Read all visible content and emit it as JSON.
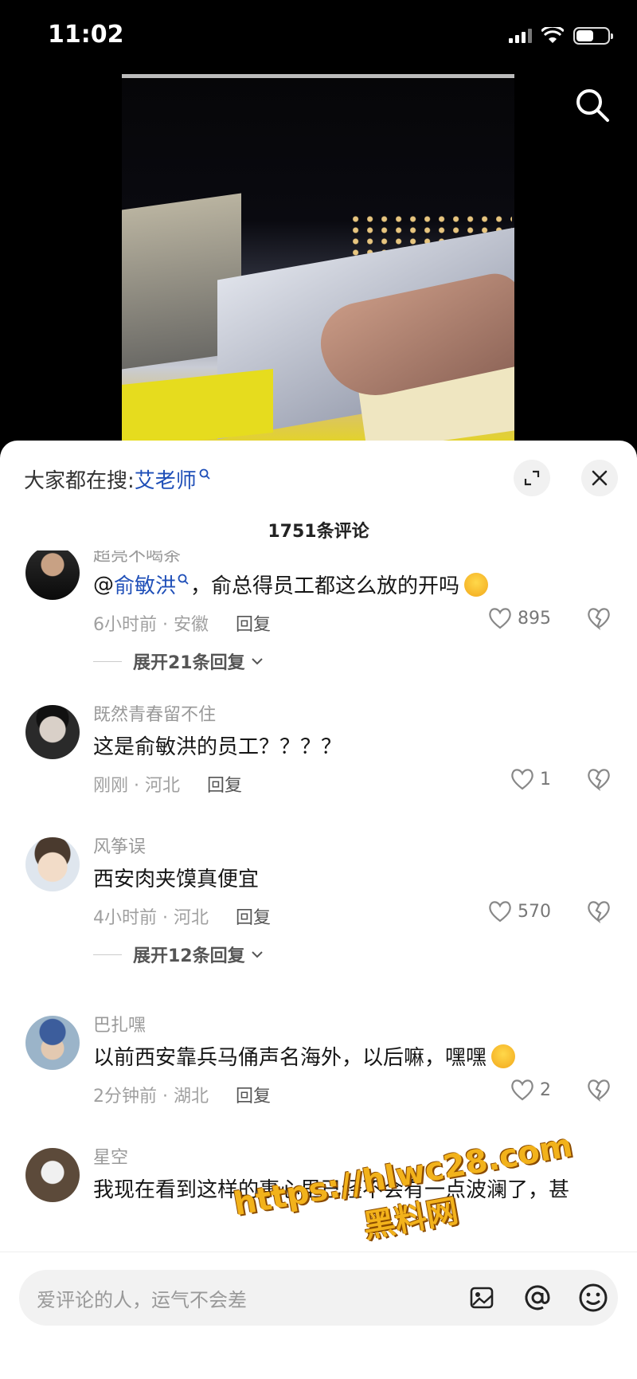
{
  "status_bar": {
    "time": "11:02"
  },
  "sheet": {
    "trending_prefix": "大家都在搜:",
    "trending_term": "艾老师",
    "comment_count": "1751条评论"
  },
  "comments": [
    {
      "user": "超亮不喝茶",
      "text_prefix": "@",
      "mention": "俞敏洪",
      "text": "，俞总得员工都这么放的开吗",
      "meta": "6小时前 · 安徽",
      "reply": "回复",
      "likes": "895",
      "expand": "展开21条回复"
    },
    {
      "user": "既然青春留不住",
      "text": "这是俞敏洪的员工？？？？",
      "meta": "刚刚 · 河北",
      "reply": "回复",
      "likes": "1"
    },
    {
      "user": "风筝误",
      "text": "西安肉夹馍真便宜",
      "meta": "4小时前 · 河北",
      "reply": "回复",
      "likes": "570",
      "expand": "展开12条回复"
    },
    {
      "user": "巴扎嘿",
      "text": "以前西安靠兵马俑声名海外，以后嘛，嘿嘿",
      "meta": "2分钟前 · 湖北",
      "reply": "回复",
      "likes": "2"
    },
    {
      "user": "星空",
      "text": "我现在看到这样的事心里已经不会有一点波澜了，甚"
    }
  ],
  "input": {
    "placeholder": "爱评论的人，运气不会差"
  },
  "watermark": {
    "line1": "https://hlwc28.com",
    "line2": "黑料网"
  },
  "icons": [
    "search-icon",
    "expand-icon",
    "close-icon",
    "heart-icon",
    "broken-heart-icon",
    "at-icon",
    "emoji-icon",
    "image-icon"
  ],
  "colors": {
    "mention": "#1f4fb8",
    "sheet_bg": "#ffffff",
    "watermark": "#f2b21b"
  }
}
